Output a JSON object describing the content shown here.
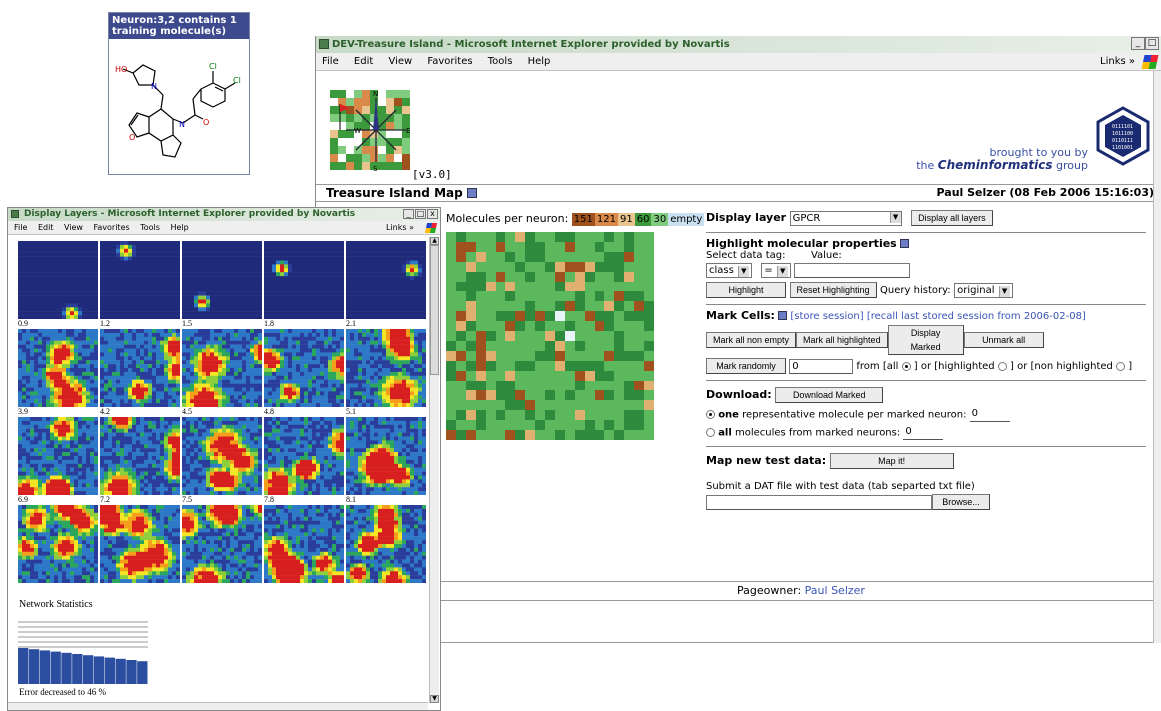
{
  "popup": {
    "header": "Neuron:3,2 contains 1 training molecule(s)",
    "atoms": {
      "ho": "HO",
      "n1": "N",
      "n2": "N",
      "o1": "O",
      "o2": "O",
      "cl1": "Cl",
      "cl2": "Cl"
    }
  },
  "main_window": {
    "title": "DEV-Treasure Island - Microsoft Internet Explorer provided by Novartis",
    "controls": {
      "minimize": "_",
      "maximize": "□",
      "close": "x"
    },
    "menu": [
      "File",
      "Edit",
      "View",
      "Favorites",
      "Tools",
      "Help"
    ],
    "links_label": "Links »",
    "version": "[v3.0]",
    "compass": {
      "n": "N",
      "s": "S",
      "e": "E",
      "w": "W"
    },
    "brought_line": "brought to you by",
    "brought_pre": "the",
    "brought_brand": "Cheminformatics",
    "brought_post": "group",
    "page_title": "Treasure Island Map",
    "owner_line": "Paul Selzer (08 Feb 2006 15:16:03)",
    "legend": {
      "label": "Molecules per neuron:",
      "items": [
        {
          "text": "151",
          "color": "#a0521e"
        },
        {
          "text": "121",
          "color": "#d9894a"
        },
        {
          "text": "91",
          "color": "#e9c48f"
        },
        {
          "text": "60",
          "color": "#3c9a3c"
        },
        {
          "text": "30",
          "color": "#7fcc7f"
        },
        {
          "text": "empty",
          "color": "#c8e0f0"
        }
      ]
    },
    "display_layer": {
      "label": "Display layer",
      "value": "GPCR",
      "button": "Display all layers"
    },
    "highlight": {
      "title": "Highlight molecular properties",
      "select_label": "Select data tag:",
      "value_label": "Value:",
      "tag": "class",
      "op": "=",
      "value": "",
      "btn_highlight": "Highlight",
      "btn_reset": "Reset Highlighting",
      "history_label": "Query history:",
      "history_value": "original"
    },
    "mark": {
      "title": "Mark Cells:",
      "store": "[store session]",
      "recall": "[recall last stored session from 2006-02-08]",
      "btn_nonempty": "Mark all non empty",
      "btn_highlighted": "Mark all highlighted",
      "btn_display": "Display Marked",
      "btn_unmark": "Unmark all",
      "btn_random": "Mark randomly",
      "random_value": "0",
      "from_all": "from [all",
      "or_highlighted": "] or [highlighted",
      "or_non": "] or [non highlighted",
      "close_bracket": "]"
    },
    "download": {
      "label": "Download:",
      "button": "Download Marked",
      "opt1_bold": "one",
      "opt1_rest": "representative molecule per marked neuron:",
      "opt1_value": "0",
      "opt2_bold": "all",
      "opt2_rest": "molecules from marked neurons:",
      "opt2_value": "0"
    },
    "maptest": {
      "label": "Map new test data:",
      "button": "Map it!",
      "submit_text": "Submit a DAT file with test data (tab separted txt file)",
      "browse": "Browse..."
    },
    "pageowner_label": "Pageowner:",
    "pageowner_name": "Paul Selzer"
  },
  "layers_window": {
    "title": "Display Layers - Microsoft Internet Explorer provided by Novartis",
    "controls": {
      "minimize": "_",
      "maximize": "□",
      "close": "x"
    },
    "menu": [
      "File",
      "Edit",
      "View",
      "Favorites",
      "Tools",
      "Help"
    ],
    "links_label": "Links »",
    "row_labels": [
      [
        "0.9",
        "1.2",
        "1.5",
        "1.8",
        "2.1"
      ],
      [
        "3.9",
        "4.2",
        "4.5",
        "4.8",
        "5.1"
      ],
      [
        "6.9",
        "7.2",
        "7.5",
        "7.8",
        "8.1"
      ]
    ],
    "network_stats": "Network Statistics",
    "error_text": "Error decreased to 46 %"
  },
  "colors": {
    "map_dark_green": "#2e8b3e",
    "map_mid_green": "#5cb85c",
    "map_brown": "#a0521e",
    "map_tan": "#e0b070",
    "heat_blue": "#1f2a7a",
    "heat_red": "#d81f1f",
    "brand_blue": "#3a4fa8"
  }
}
